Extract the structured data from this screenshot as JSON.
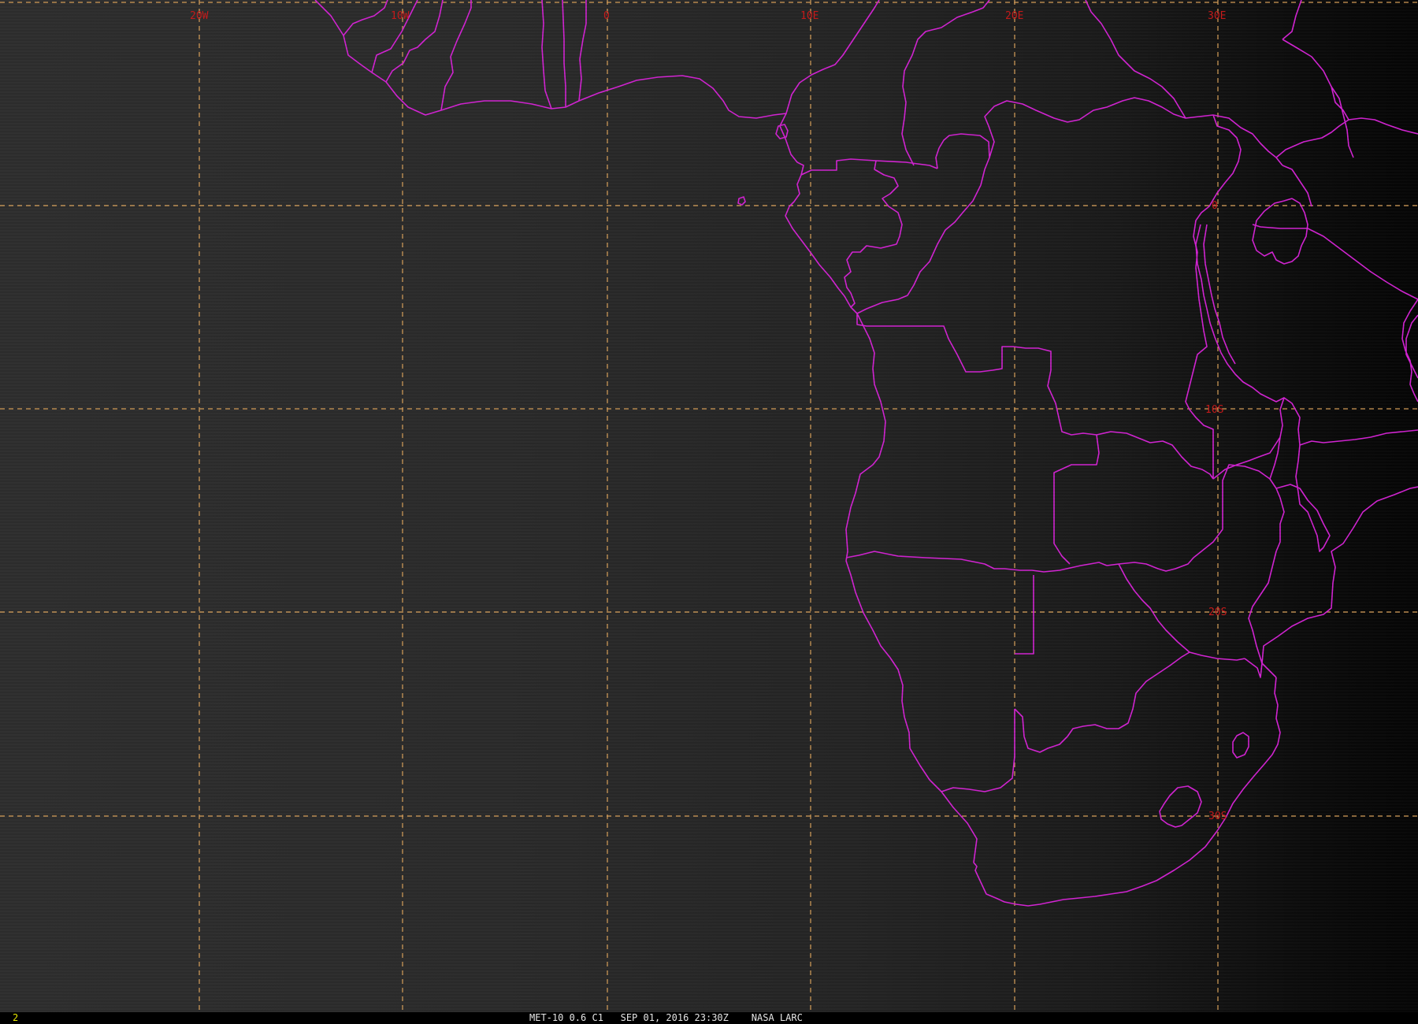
{
  "map": {
    "lon_labels": [
      "20W",
      "10W",
      "0",
      "10E",
      "20E",
      "30E"
    ],
    "lat_labels": [
      "0",
      "10S",
      "20S",
      "30S"
    ],
    "colors": {
      "grid": "#d9a15a",
      "grid_label": "#c81a1a",
      "borders": "#d222d2"
    }
  },
  "status_bar": {
    "frame_number": "2",
    "satellite": "MET-10 0.6 C1",
    "datetime": "SEP 01, 2016 23:30Z",
    "source": "NASA LARC"
  }
}
